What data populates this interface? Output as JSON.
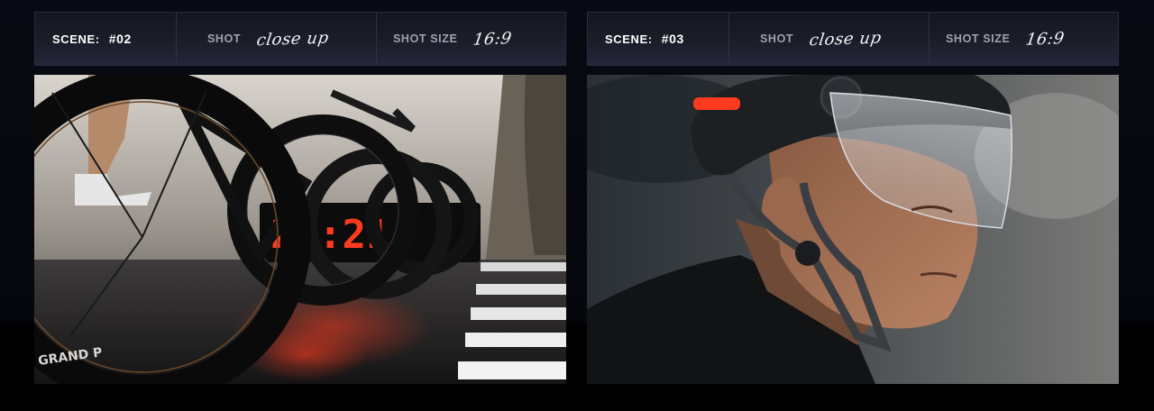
{
  "panels": [
    {
      "scene_label": "SCENE:",
      "scene_number": "#02",
      "shot_label": "SHOT",
      "shot_value": "close up",
      "size_label": "SHOT SIZE",
      "size_value": "16:9",
      "image_icon": "bicycle-wheels-start-line-image",
      "tire_brand": "GRAND P",
      "timer_display": "27:21"
    },
    {
      "scene_label": "SCENE:",
      "scene_number": "#03",
      "shot_label": "SHOT",
      "shot_value": "close up",
      "size_label": "SHOT SIZE",
      "size_value": "16:9",
      "image_icon": "cyclist-helmet-portrait-image"
    }
  ],
  "colors": {
    "background": "#05070c",
    "header_border": "#2a2e3c",
    "accent_red": "#ff3b1f"
  }
}
